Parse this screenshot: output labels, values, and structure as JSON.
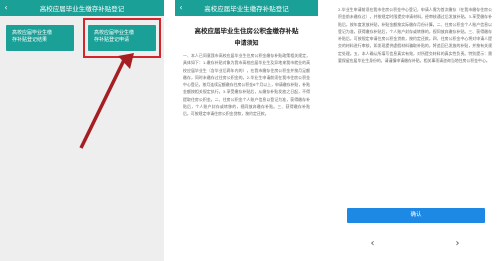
{
  "screen1": {
    "nav_title": "高校应届毕业生缴存补贴登记",
    "back_glyph": "‹",
    "tile1_lines": [
      "高校应届毕业生缴",
      "存补贴登记结果"
    ],
    "tile2_lines": [
      "高校应届毕业生缴",
      "存补贴登记申请"
    ],
    "highlight_color": "#d2262b"
  },
  "screen2": {
    "nav_title": "高校应届毕业生缴存补贴登记",
    "back_glyph": "‹",
    "heading": "高校应届毕业生住房公积金缴存补贴",
    "subheading": "申请须知",
    "body": "一、本人已同意我市高校应届毕业生住房公积金缴存补贴政策相关规定，具体如下：1.缴存补贴对象为我市高校应届毕业生及异地来我市就业的高校应届毕业生（含毕业后两年内的），在我市缴存住房公积金并按月足额缴存，同时未缴存过住房公积金的。2.毕业生申请前须在我市住房公积金中心登记，按月连续足额缴存住房公积金6个月以上，申请缴存补贴，补贴金额按相关规定执行。3.享受缴存补贴后，从缴存补贴发放之日起，不得提取住房公积金。二、住房公积金个人账户信息以登记为准，获得缴存补贴后，个人账户封存或转移的，视同放弃缴存补贴。三、获得缴存补贴后，可按规定申请住房公积金贷款，按约定还款。"
  },
  "screen3": {
    "body": "2.毕业生申请前须在我市住房公积金中心登记，申请人需为首次缴存（在我市缴存住房公积金前未缴存过），并按规定时限提交申请材料，经审核通过后发放补贴。3.享受缴存补贴后，按年度发放补贴，补贴金额按实际缴存月份计算。二、住房公积金个人账户信息以登记为准，获得缴存补贴后，个人账户封存或转移的，视同放弃缴存补贴。三、获得缴存补贴后，可按规定申请住房公积金贷款，按约定还款。四、住房公积金中心将对申请人提交的材料进行审核，如发现提供虚假材料骗取补贴的，将追回已发放的补贴，并按有关规定处理。五、本人确认所填写信息真实有效，对所提交材料的真实性负责。特别提示：需要保留应届毕业生身份的，请谨慎申请缴存补贴，相关事项请咨询当地住房公积金中心。",
    "confirm_label": "确认",
    "prev_glyph": "‹",
    "next_glyph": "›"
  }
}
